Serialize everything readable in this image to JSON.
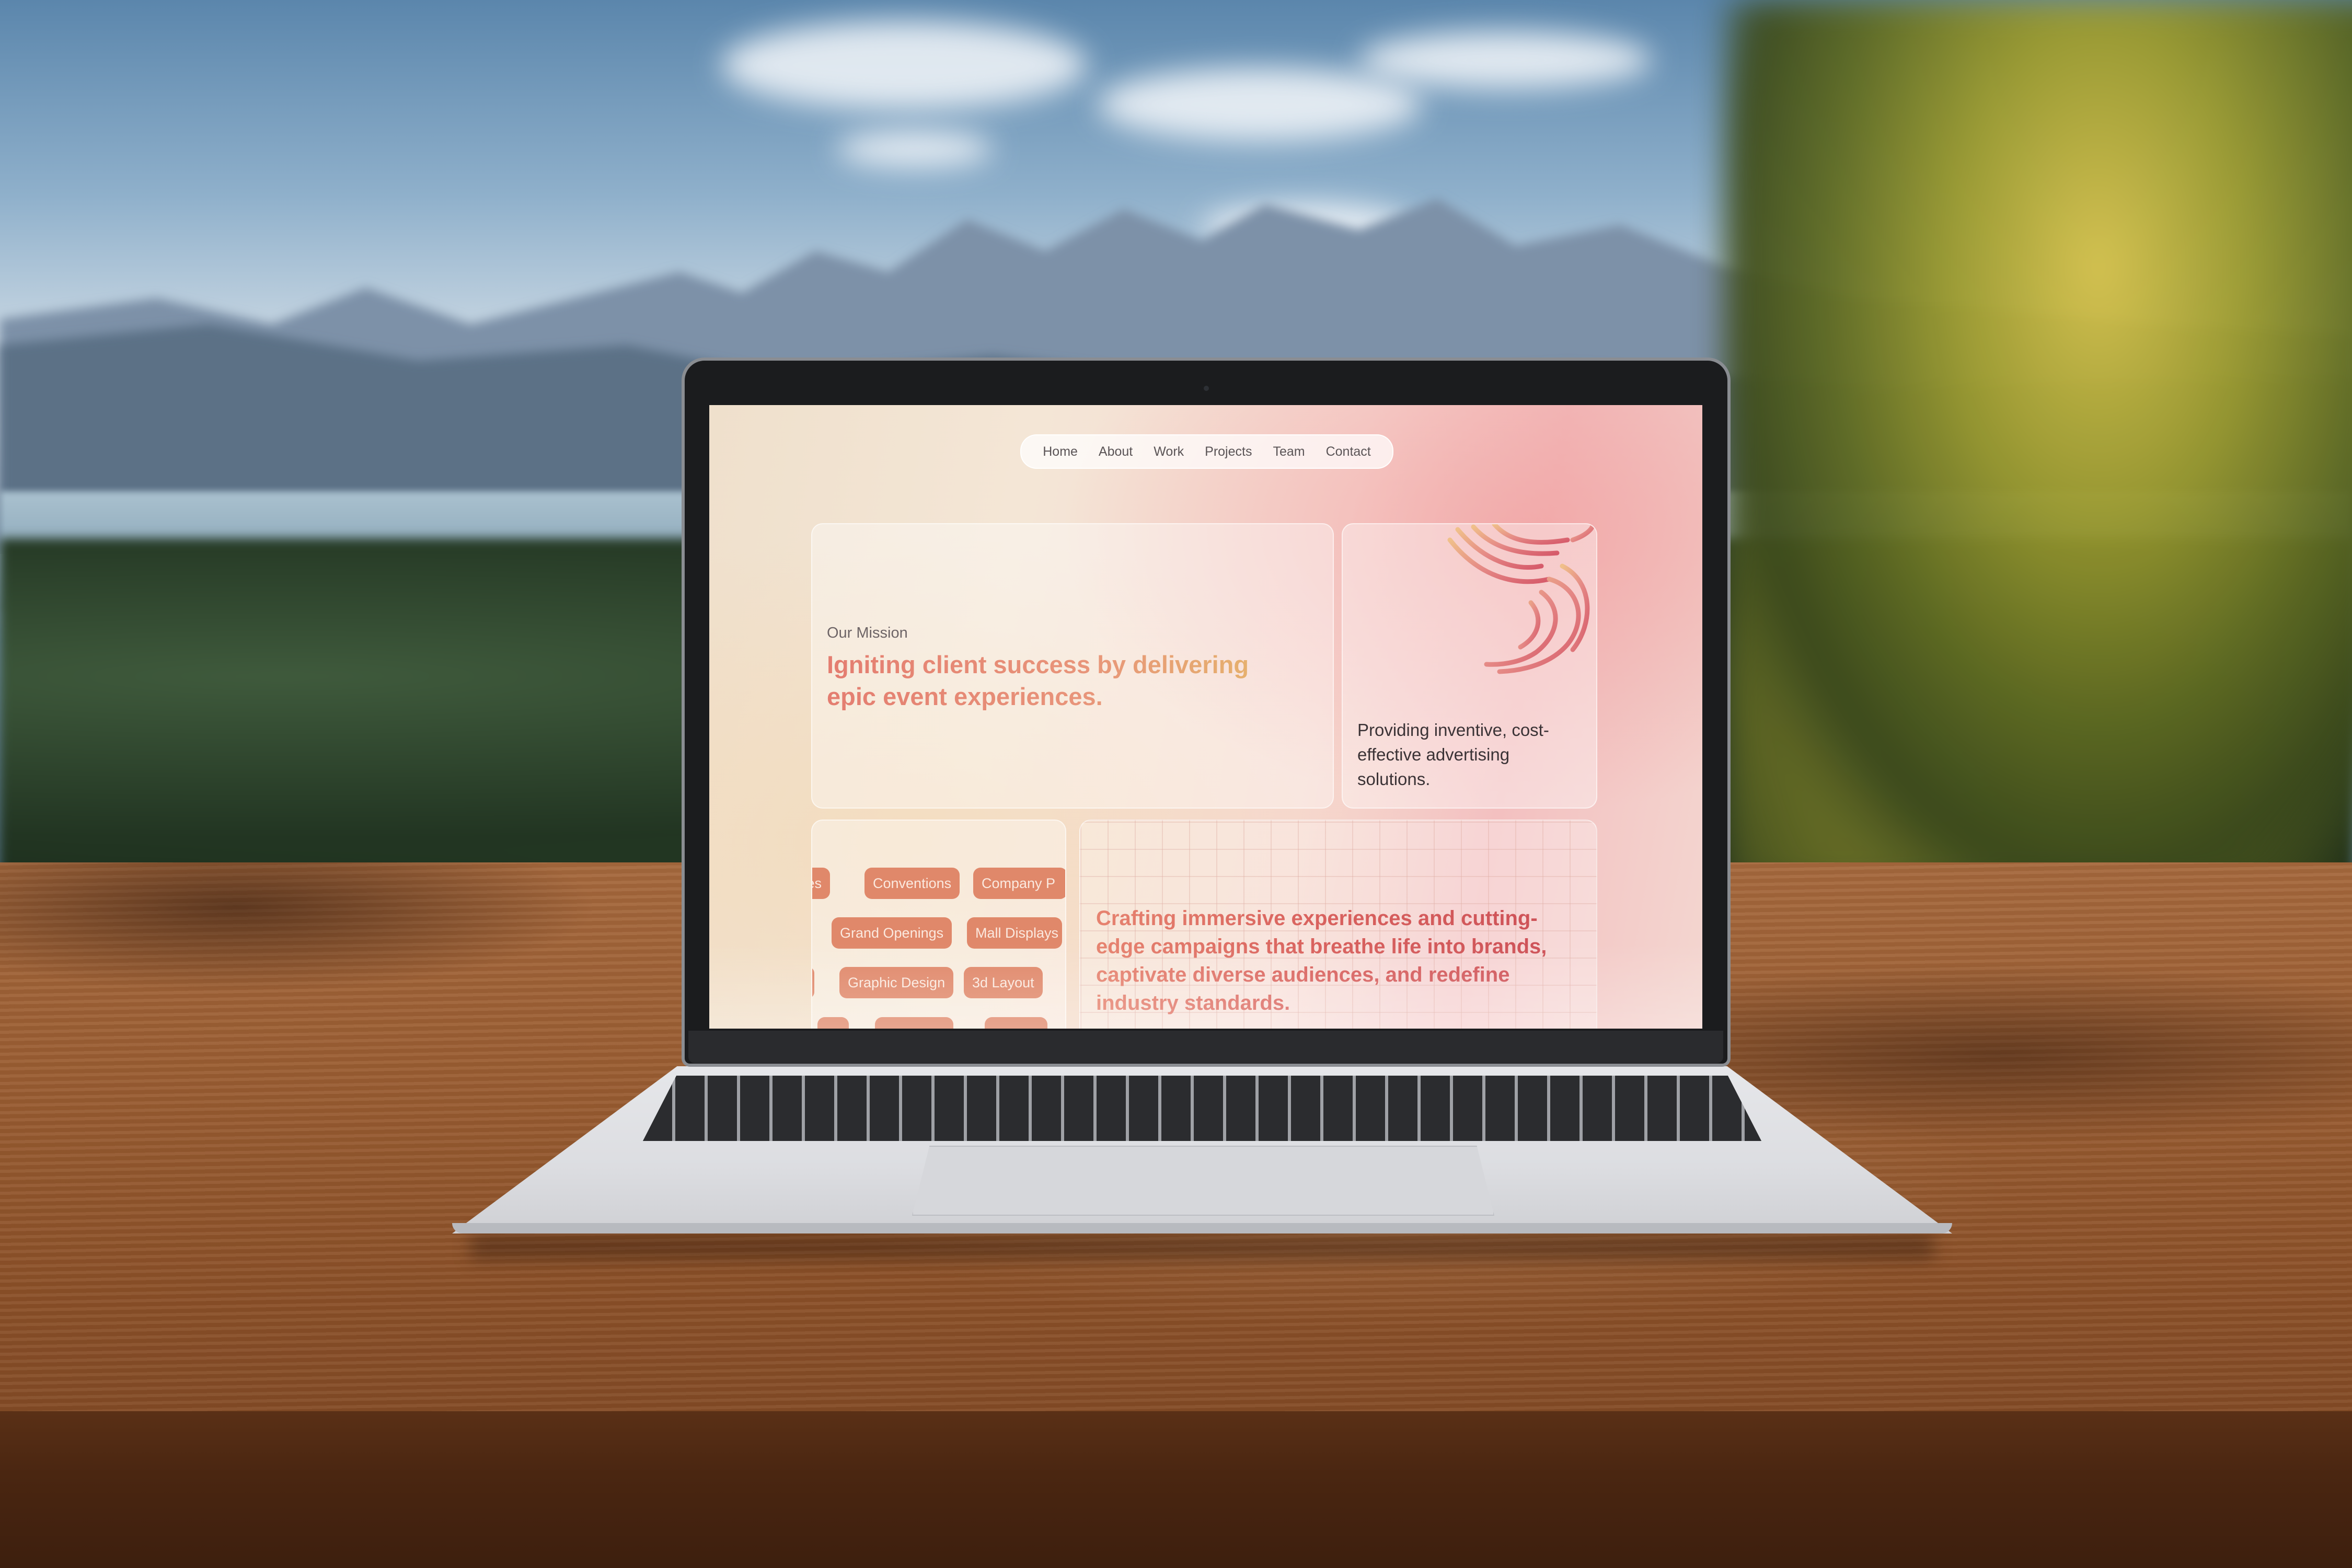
{
  "nav": {
    "items": [
      {
        "label": "Home"
      },
      {
        "label": "About"
      },
      {
        "label": "Work"
      },
      {
        "label": "Projects"
      },
      {
        "label": "Team"
      },
      {
        "label": "Contact"
      }
    ]
  },
  "mission": {
    "label": "Our Mission",
    "title": "Igniting client success by delivering epic event experiences."
  },
  "logo_card": {
    "text": "Providing inventive, cost-effective advertising solutions."
  },
  "tags": {
    "row1": [
      "ces",
      "Conventions",
      "Company P"
    ],
    "row2": [
      "Grand Openings",
      "Mall Displays"
    ],
    "row3": [
      "",
      "Graphic Design",
      "3d Layout"
    ]
  },
  "crafting": {
    "text": "Crafting immersive experiences and cutting-edge campaigns that breathe life into brands, captivate diverse audiences, and redefine industry standards."
  },
  "colors": {
    "accent_orange": "#e0886a",
    "accent_red": "#cc4f57",
    "accent_gold": "#e5b86a"
  }
}
